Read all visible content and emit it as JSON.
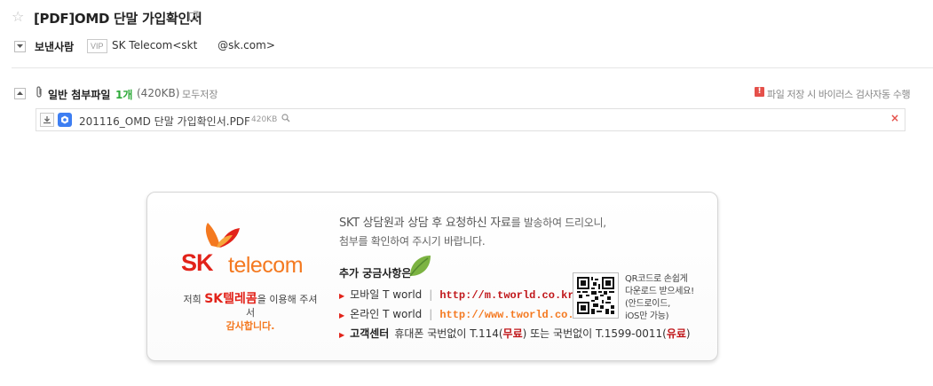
{
  "header": {
    "subject": "[PDF]OMD 단말 가입확인서",
    "sender_label": "보낸사람",
    "vip_badge": "VIP",
    "sender_address": "SK Telecom<skt      @sk.com>"
  },
  "attachments": {
    "title": "일반 첨부파일",
    "count": "1개",
    "total_size": "(420KB)",
    "save_all": "모두저장",
    "scan_icon_text": "!",
    "scan_note": "파일 저장 시 바이러스 검사자동 수행",
    "files": [
      {
        "name": "201116_OMD 단말 가입확인서.PDF",
        "size": "420KB"
      }
    ]
  },
  "banner": {
    "logo_sk": "SK",
    "logo_telecom": "telecom",
    "thanks_pre": "저희 ",
    "thanks_brand": "SK텔레콤",
    "thanks_post": "을 이용해 주셔서",
    "thanks_line2": "감사합니다.",
    "intro_big": "SKT 상담원과 상담 후 요청하신 자료",
    "intro_small": "를 발송하여 드리오니,",
    "intro_line2": "첨부를 확인하여 주시기 바랍니다.",
    "more_title": "추가 궁금사항은",
    "mobile_label": "모바일 T world",
    "mobile_url": "http://m.tworld.co.kr",
    "online_label": "온라인 T world",
    "online_url": "http://www.tworld.co.kr",
    "cs_label": "고객센터",
    "cs_mobile": "휴대폰 국번없이 T.114(",
    "cs_free": "무료",
    "cs_mid": ") 또는 국번없이 T.1599-0011(",
    "cs_paid": "유료",
    "cs_end": ")",
    "qr_note": [
      "QR코드로 손쉽게",
      "다운로드 받으세요!",
      "(안드로이드,",
      "iOS만 가능)"
    ]
  },
  "colors": {
    "sk_red": "#e2231a",
    "sk_orange": "#f47920",
    "count_green": "#2eaa3a",
    "alert_red": "#e5504a"
  }
}
